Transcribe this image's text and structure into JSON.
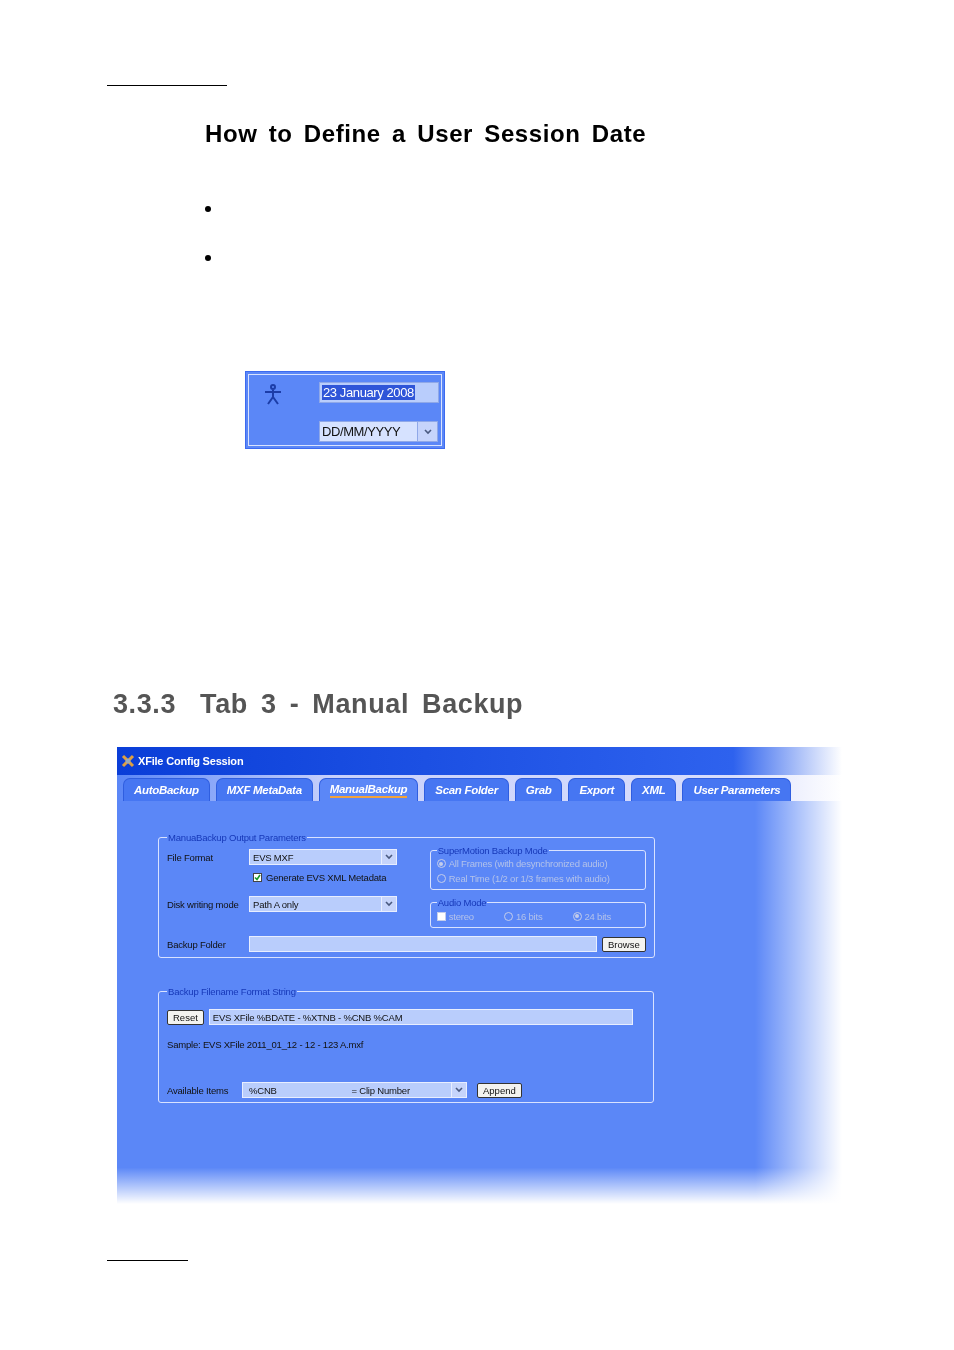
{
  "page": {
    "heading": "How to Define a User Session Date"
  },
  "date_widget": {
    "date_value": "23 January 2008",
    "date_highlighted": true,
    "format": "DD/MM/YYYY"
  },
  "section_heading": {
    "number": "3.3.3",
    "title": "Tab 3 - Manual Backup"
  },
  "window": {
    "title": "XFile Config Session",
    "tabs": [
      {
        "label": "AutoBackup",
        "selected": false
      },
      {
        "label": "MXF MetaData",
        "selected": false
      },
      {
        "label": "ManualBackup",
        "selected": true
      },
      {
        "label": "Scan Folder",
        "selected": false
      },
      {
        "label": "Grab",
        "selected": false
      },
      {
        "label": "Export",
        "selected": false
      },
      {
        "label": "XML",
        "selected": false
      },
      {
        "label": "User Parameters",
        "selected": false
      }
    ],
    "output_parameters": {
      "legend": "ManuaBackup Output Parameters",
      "file_format": {
        "label": "File Format",
        "value": "EVS MXF"
      },
      "generate_xml": {
        "label": "Generate EVS XML Metadata",
        "checked": true
      },
      "disk_writing_mode": {
        "label": "Disk writing mode",
        "value": "Path A only"
      },
      "backup_folder": {
        "label": "Backup Folder"
      },
      "browse_button": "Browse",
      "supermotion": {
        "legend": "SuperMotion Backup Mode",
        "disabled": true,
        "options": [
          {
            "label": "All Frames (with desynchronized audio)",
            "selected": true
          },
          {
            "label": "Real Time (1/2 or 1/3 frames with audio)",
            "selected": false
          }
        ]
      },
      "audio_mode": {
        "legend": "Audio Mode",
        "disabled": true,
        "stereo": {
          "label": "stereo",
          "checked": false
        },
        "bits": [
          {
            "label": "16 bits",
            "selected": false
          },
          {
            "label": "24 bits",
            "selected": true
          }
        ]
      }
    },
    "filename_format": {
      "legend": "Backup Filename Format String",
      "reset_button": "Reset",
      "format_value": "EVS XFile %BDATE - %XTNB - %CNB %CAM",
      "sample": "Sample: EVS XFile 2011_01_12 - 12 - 123 A.mxf",
      "available_items": {
        "label": "Available Items",
        "code": "%CNB",
        "description": "= Clip Number"
      },
      "append_button": "Append"
    }
  }
}
